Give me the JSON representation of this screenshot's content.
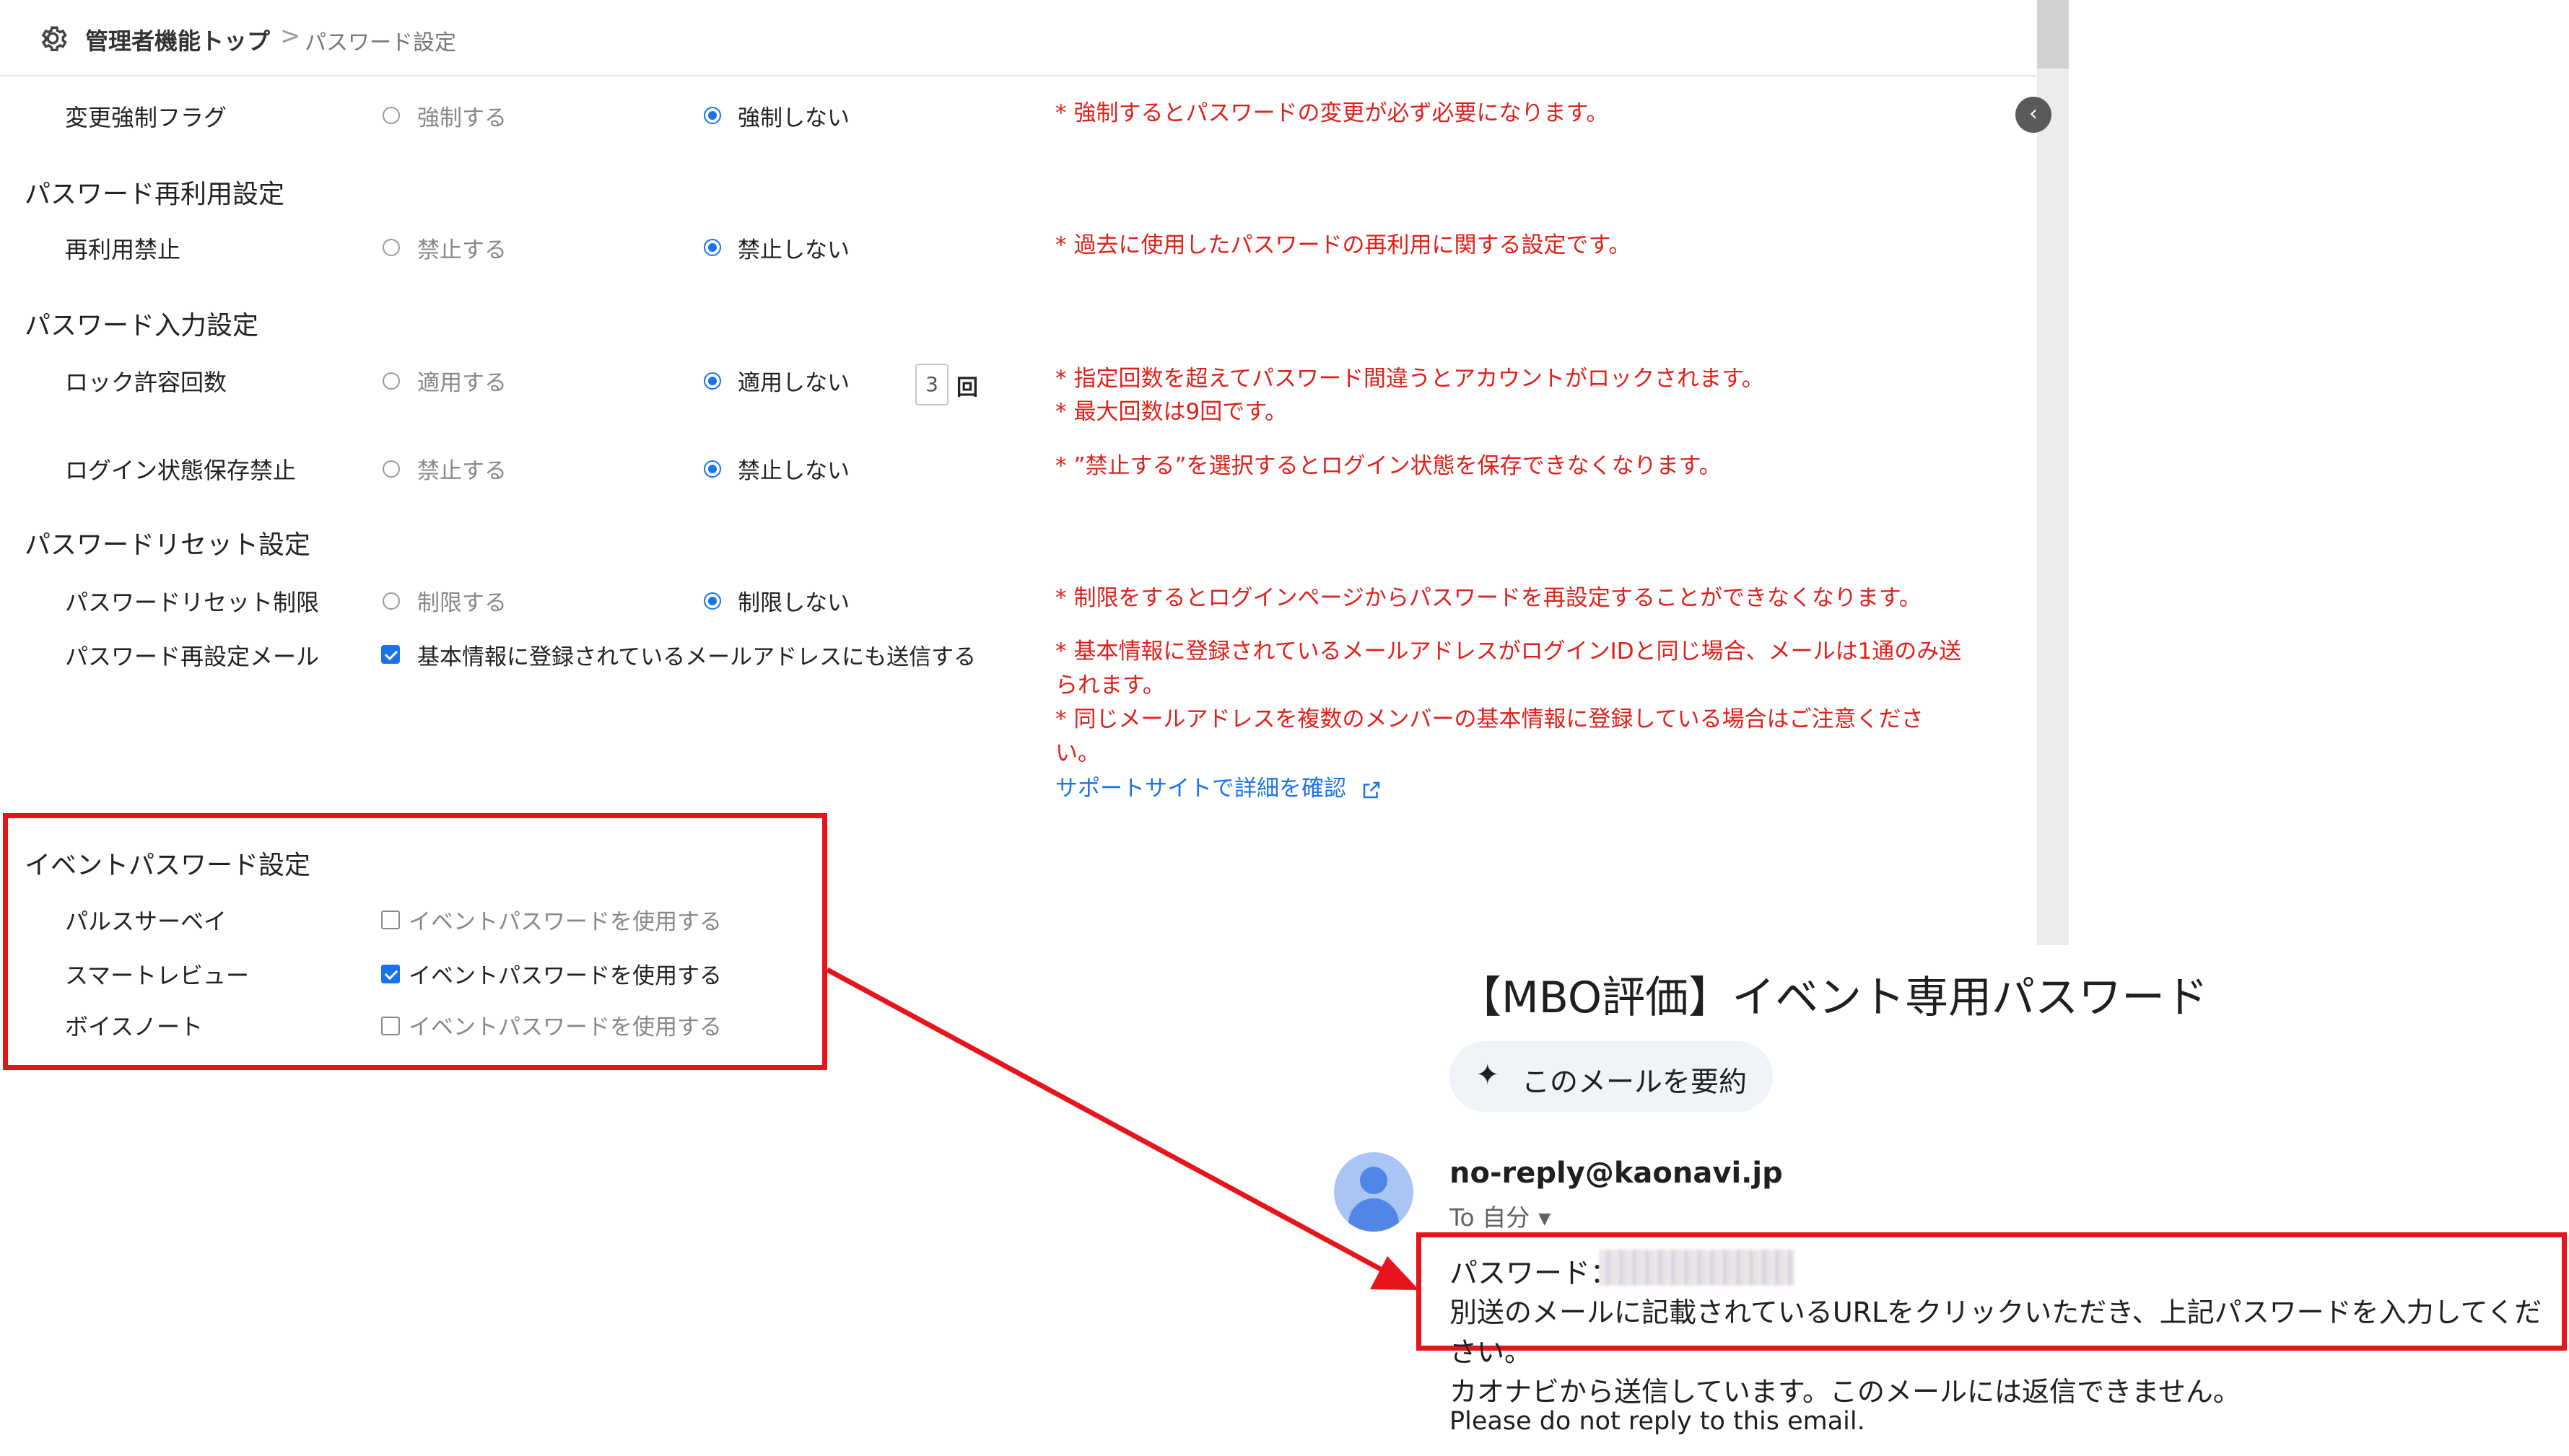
{
  "breadcrumb": {
    "home": "管理者機能トップ",
    "separator": ">",
    "current": "パスワード設定"
  },
  "sections": {
    "reuse": "パスワード再利用設定",
    "input": "パスワード入力設定",
    "reset": "パスワードリセット設定",
    "event": "イベントパスワード設定"
  },
  "rows": {
    "force_change": {
      "label": "変更強制フラグ",
      "opt_a": "強制する",
      "opt_b": "強制しない",
      "note": "強制するとパスワードの変更が必ず必要になります。"
    },
    "reuse_ban": {
      "label": "再利用禁止",
      "opt_a": "禁止する",
      "opt_b": "禁止しない",
      "note": "過去に使用したパスワードの再利用に関する設定です。"
    },
    "lock_count": {
      "label": "ロック許容回数",
      "opt_a": "適用する",
      "opt_b": "適用しない",
      "count_value": "3",
      "unit": "回",
      "note1": "指定回数を超えてパスワード間違うとアカウントがロックされます。",
      "note2": "最大回数は9回です。"
    },
    "login_keep": {
      "label": "ログイン状態保存禁止",
      "opt_a": "禁止する",
      "opt_b": "禁止しない",
      "note": "”禁止する”を選択するとログイン状態を保存できなくなります。"
    },
    "reset_limit": {
      "label": "パスワードリセット制限",
      "opt_a": "制限する",
      "opt_b": "制限しない",
      "note": "制限をするとログインページからパスワードを再設定することができなくなります。"
    },
    "reset_mail": {
      "label": "パスワード再設定メール",
      "checkbox": "基本情報に登録されているメールアドレスにも送信する",
      "note1a": "基本情報に登録されているメールアドレスがログインIDと同じ場合、メールは1通のみ送",
      "note1b": "られます。",
      "note2a": "同じメールアドレスを複数のメンバーの基本情報に登録している場合はご注意くださ",
      "note2b": "い。",
      "link": "サポートサイトで詳細を確認"
    }
  },
  "note_star": "*",
  "event_rows": [
    {
      "label": "パルスサーベイ",
      "option": "イベントパスワードを使用する",
      "checked": false
    },
    {
      "label": "スマートレビュー",
      "option": "イベントパスワードを使用する",
      "checked": true
    },
    {
      "label": "ボイスノート",
      "option": "イベントパスワードを使用する",
      "checked": false
    }
  ],
  "email": {
    "subject": "【MBO評価】イベント専用パスワード",
    "summary_button": "このメールを要約",
    "sender": "no-reply@kaonavi.jp",
    "to": "To 自分",
    "password_label": "パスワード：",
    "body_line": "別送のメールに記載されているURLをクリックいただき、上記パスワードを入力してください。",
    "footer_ja": "カオナビから送信しています。このメールには返信できません。",
    "footer_en": "Please do not reply to this email."
  },
  "colors": {
    "accent": "#1a73e8",
    "note_red": "#e0201b",
    "highlight_red": "#e8141b"
  }
}
